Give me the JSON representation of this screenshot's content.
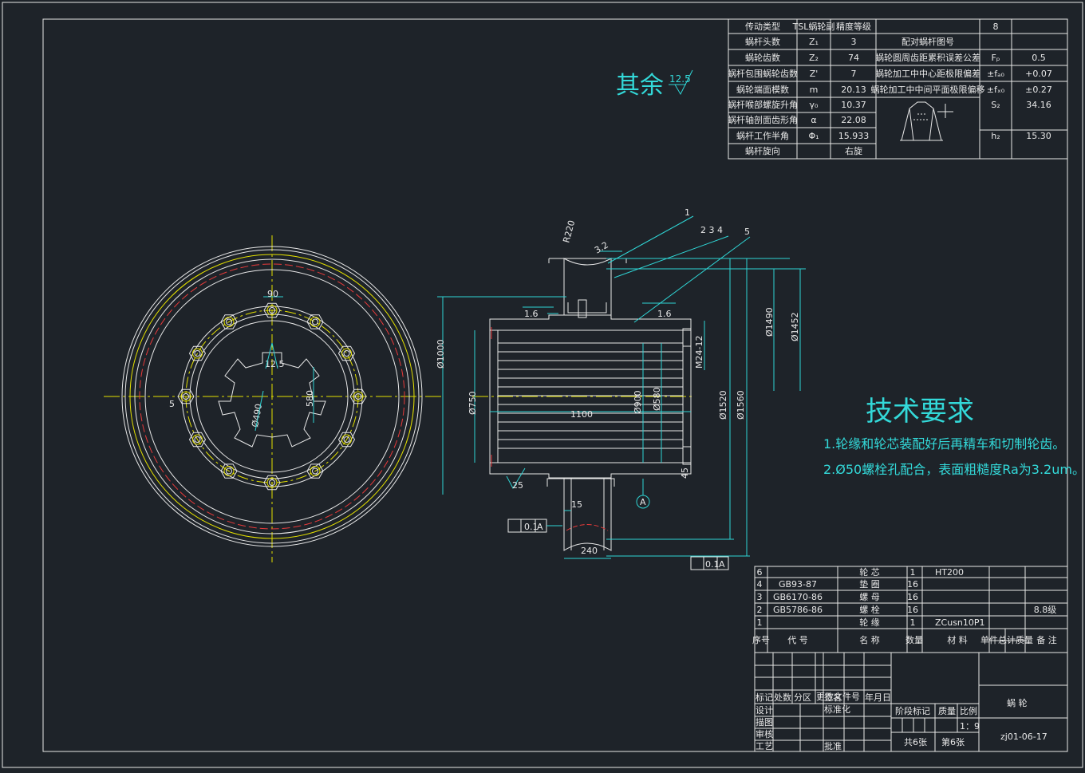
{
  "param_table": {
    "rows": [
      [
        "传动类型",
        "TSL蜗轮副",
        "精度等级",
        "",
        "8"
      ],
      [
        "蜗杆头数",
        "Z₁",
        "3",
        "配对蜗杆图号",
        ""
      ],
      [
        "蜗轮齿数",
        "Z₂",
        "74",
        "蜗轮圆周齿距累积误差公差",
        "Fₚ",
        "0.5"
      ],
      [
        "蜗杆包围蜗轮齿数",
        "Z'",
        "7",
        "蜗轮加工中中心距极限偏差",
        "±fₐ₀",
        "+0.07"
      ],
      [
        "蜗轮端面模数",
        "m",
        "20.13",
        "蜗轮加工中中间平面极限偏移",
        "±fₓ₀",
        "±0.27"
      ],
      [
        "蜗杆喉部螺旋升角",
        "γ₀",
        "10.37",
        "",
        "S₂",
        "34.16"
      ],
      [
        "蜗杆轴剖面齿形角",
        "α",
        "22.08",
        "",
        "",
        ""
      ],
      [
        "蜗杆工作半角",
        "Φ₁",
        "15.933",
        "",
        "h₂",
        "15.30"
      ],
      [
        "蜗杆旋向",
        "",
        "右旋",
        "",
        "",
        ""
      ]
    ]
  },
  "roughness_note": {
    "label": "其余",
    "value": "12.5"
  },
  "tech_req": {
    "title": "技术要求",
    "line1": "1.轮缘和轮芯装配好后再精车和切制轮齿。",
    "line2": "2.Ø50螺栓孔配合，表面粗糙度Ra为3.2um。"
  },
  "front_view": {
    "dims": {
      "top": "90",
      "roughness": "12.5",
      "bore": "Ø490",
      "key": "580",
      "chamfer": "5"
    }
  },
  "section_view": {
    "balloons": [
      "1",
      "2 3 4",
      "5"
    ],
    "dims": [
      "R220",
      "3.2",
      "1.6",
      "1.6",
      "Ø1000",
      "Ø750",
      "1100",
      "Ø900",
      "Ø580",
      "M24-12",
      "Ø1520",
      "Ø1560",
      "Ø1490",
      "Ø1452",
      "25",
      "15",
      "240",
      "45"
    ],
    "datum": "A",
    "tolerance_frame_1": "0.1",
    "tolerance_frame_2": "0.1",
    "datum_ref": "A"
  },
  "parts_list": {
    "rows": [
      [
        "6",
        "",
        "轮 芯",
        "1",
        "HT200",
        ""
      ],
      [
        "4",
        "GB93-87",
        "垫 圈",
        "16",
        "",
        ""
      ],
      [
        "3",
        "GB6170-86",
        "螺 母",
        "16",
        "",
        ""
      ],
      [
        "2",
        "GB5786-86",
        "螺 栓",
        "16",
        "",
        "8.8级"
      ],
      [
        "1",
        "",
        "轮 缘",
        "1",
        "ZCusn10P1",
        ""
      ]
    ],
    "header": [
      "序号",
      "代 号",
      "名 称",
      "数量",
      "材 料",
      "单件总计质量",
      "备 注"
    ]
  },
  "title_block": {
    "part_name": "蜗 轮",
    "drawing_no": "zj01-06-17",
    "labels": [
      "标记",
      "处数",
      "分区",
      "更改文件号",
      "签名",
      "年月日",
      "设计",
      "标准化",
      "描图",
      "审核",
      "工艺",
      "批准",
      "阶段标记",
      "质量",
      "比例"
    ],
    "scale": "1：9",
    "sheets_total": "共6张",
    "sheet_no": "第6张"
  },
  "colors": {
    "background": "#1e2329",
    "cyan": "#2fd5d5",
    "white": "#e8e8e8",
    "yellow": "#e4e000",
    "red": "#e83a3a"
  }
}
